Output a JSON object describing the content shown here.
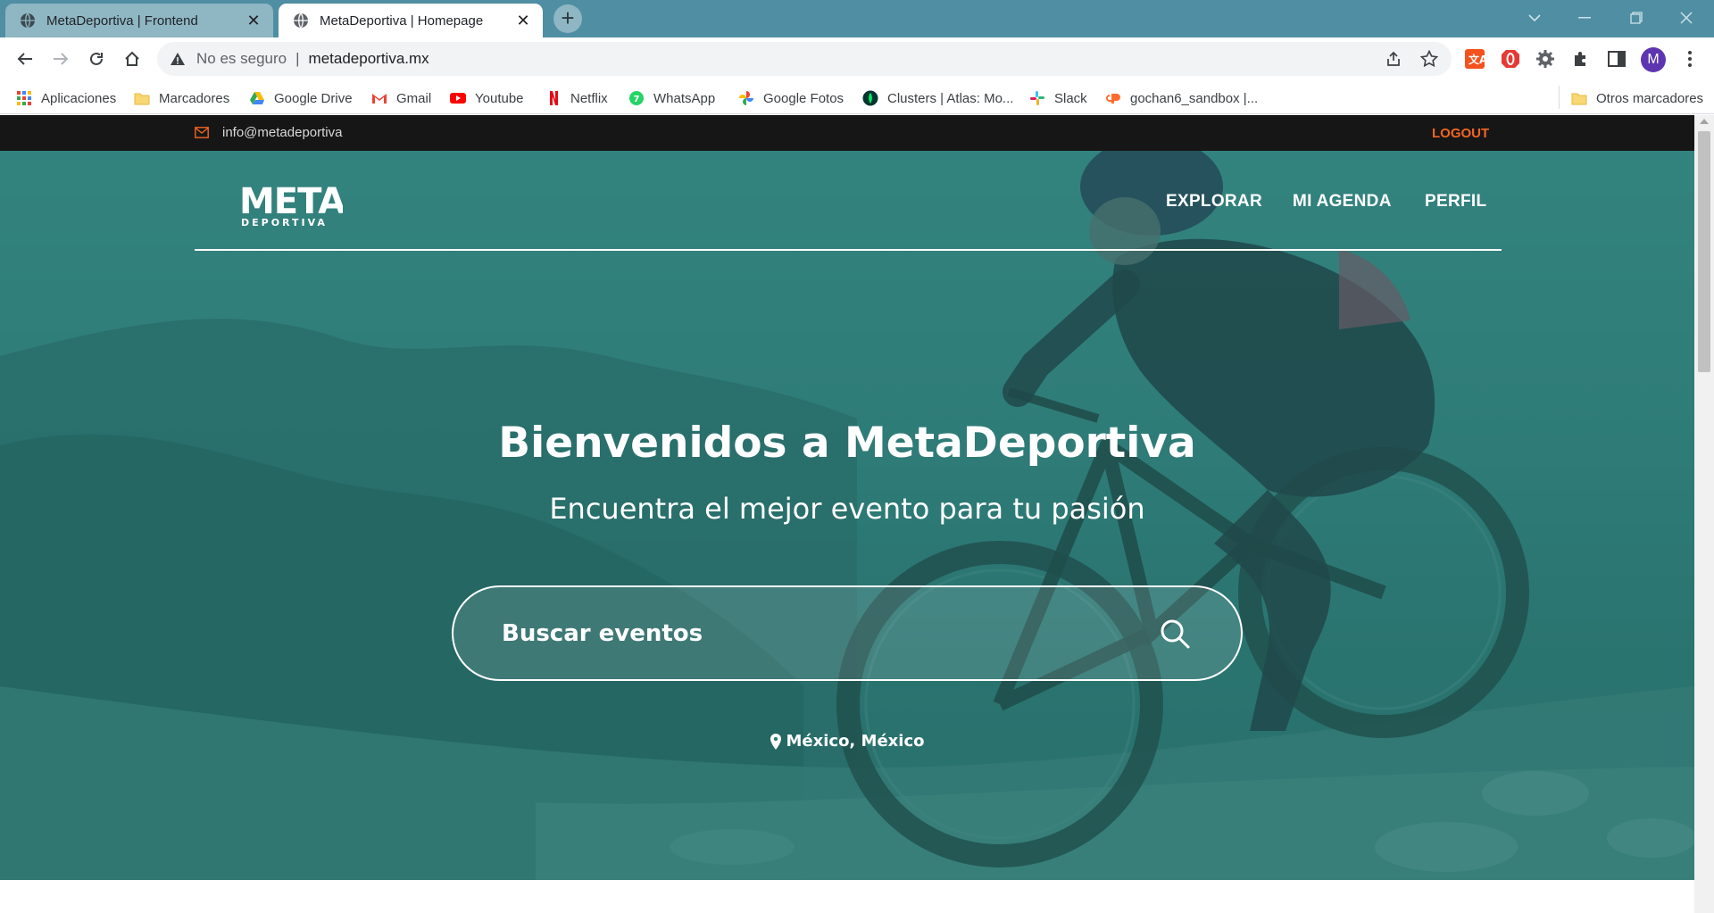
{
  "browser": {
    "tabs": [
      {
        "title": "MetaDeportiva | Frontend",
        "active": false
      },
      {
        "title": "MetaDeportiva | Homepage",
        "active": true
      }
    ],
    "new_tab_icon": "plus-icon",
    "address": {
      "security_label": "No es seguro",
      "url": "metadeportiva.mx"
    },
    "profile_initial": "M",
    "bookmarks": [
      {
        "label": "Aplicaciones",
        "icon": "apps-grid-icon"
      },
      {
        "label": "Marcadores",
        "icon": "folder-icon"
      },
      {
        "label": "Google Drive",
        "icon": "drive-icon"
      },
      {
        "label": "Gmail",
        "icon": "gmail-icon"
      },
      {
        "label": "Youtube",
        "icon": "youtube-icon"
      },
      {
        "label": "Netflix",
        "icon": "netflix-icon"
      },
      {
        "label": "WhatsApp",
        "icon": "whatsapp-icon"
      },
      {
        "label": "Google Fotos",
        "icon": "photos-icon"
      },
      {
        "label": "Clusters | Atlas: Mo...",
        "icon": "mongodb-icon"
      },
      {
        "label": "Slack",
        "icon": "slack-icon"
      },
      {
        "label": "gochan6_sandbox |...",
        "icon": "cpanel-icon"
      }
    ],
    "other_bookmarks": "Otros marcadores"
  },
  "site": {
    "topbar": {
      "email": "info@metadeportiva",
      "logout": "LOGOUT"
    },
    "logo": {
      "line1": "META",
      "line2": "DEPORTIVA"
    },
    "nav": [
      "EXPLORAR",
      "MI AGENDA",
      "PERFIL"
    ],
    "hero": {
      "title": "Bienvenidos a MetaDeportiva",
      "subtitle": "Encuentra el mejor evento para tu pasión",
      "search_placeholder": "Buscar eventos",
      "location": "México, México"
    }
  },
  "colors": {
    "accent": "#f26522",
    "topbar_bg": "#161616",
    "hero_tint": "#2e7c78",
    "tabstrip": "#4f8ea3"
  }
}
